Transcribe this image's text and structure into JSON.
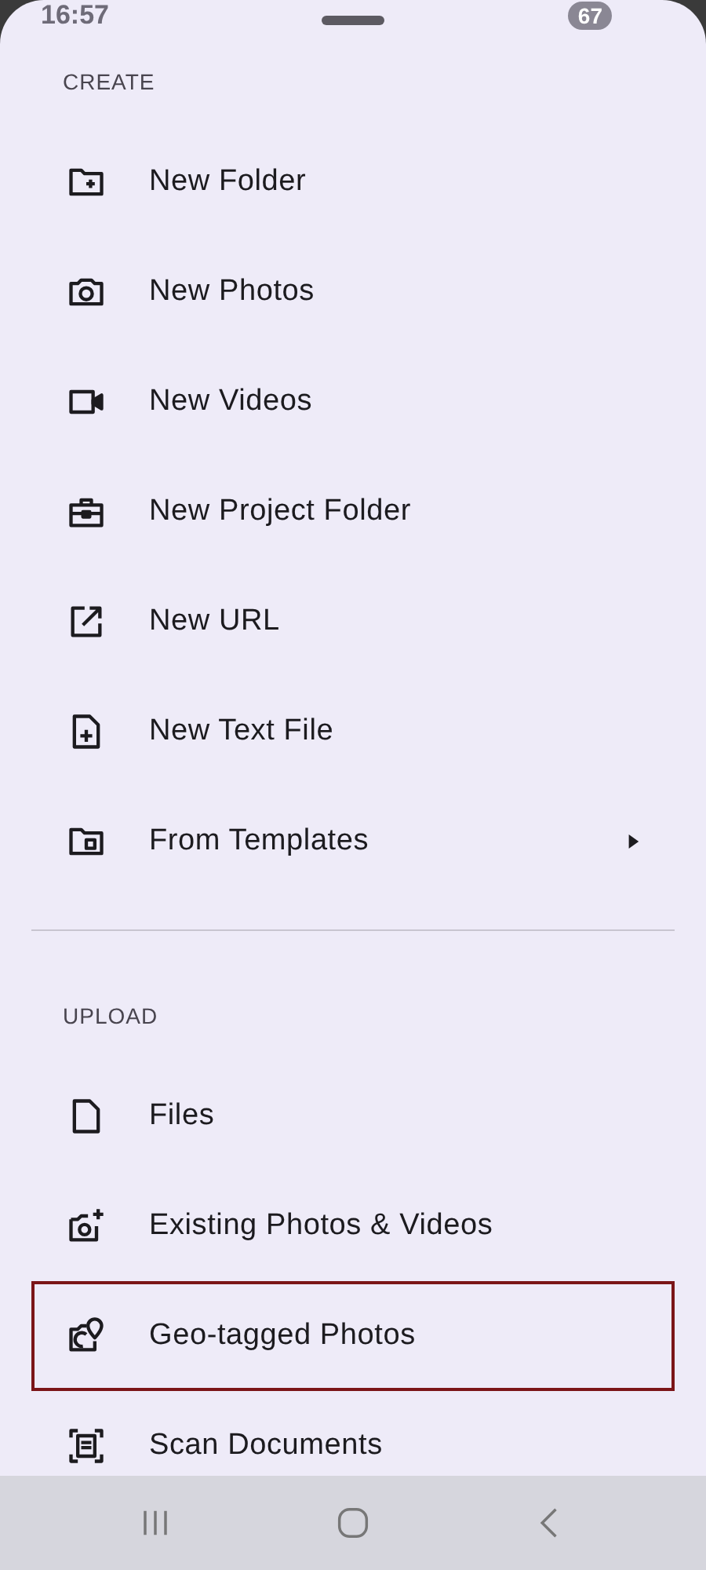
{
  "status_bar": {
    "time": "16:57",
    "battery": "67"
  },
  "sections": [
    {
      "title": "CREATE",
      "items": [
        {
          "label": "New Folder",
          "kind": "folder-plus",
          "highlighted": false,
          "has_submenu": false
        },
        {
          "label": "New Photos",
          "kind": "camera",
          "highlighted": false,
          "has_submenu": false
        },
        {
          "label": "New Videos",
          "kind": "video",
          "highlighted": false,
          "has_submenu": false
        },
        {
          "label": "New Project Folder",
          "kind": "briefcase",
          "highlighted": false,
          "has_submenu": false
        },
        {
          "label": "New URL",
          "kind": "link-out",
          "highlighted": false,
          "has_submenu": false
        },
        {
          "label": "New Text File",
          "kind": "file-plus",
          "highlighted": false,
          "has_submenu": false
        },
        {
          "label": "From Templates",
          "kind": "folder-doc",
          "highlighted": false,
          "has_submenu": true
        }
      ]
    },
    {
      "title": "UPLOAD",
      "items": [
        {
          "label": "Files",
          "kind": "file",
          "highlighted": false,
          "has_submenu": false
        },
        {
          "label": "Existing Photos & Videos",
          "kind": "camera-plus",
          "highlighted": false,
          "has_submenu": false
        },
        {
          "label": "Geo-tagged Photos",
          "kind": "geo-photo",
          "highlighted": true,
          "has_submenu": false
        },
        {
          "label": "Scan Documents",
          "kind": "scan",
          "highlighted": false,
          "has_submenu": false
        }
      ]
    }
  ]
}
